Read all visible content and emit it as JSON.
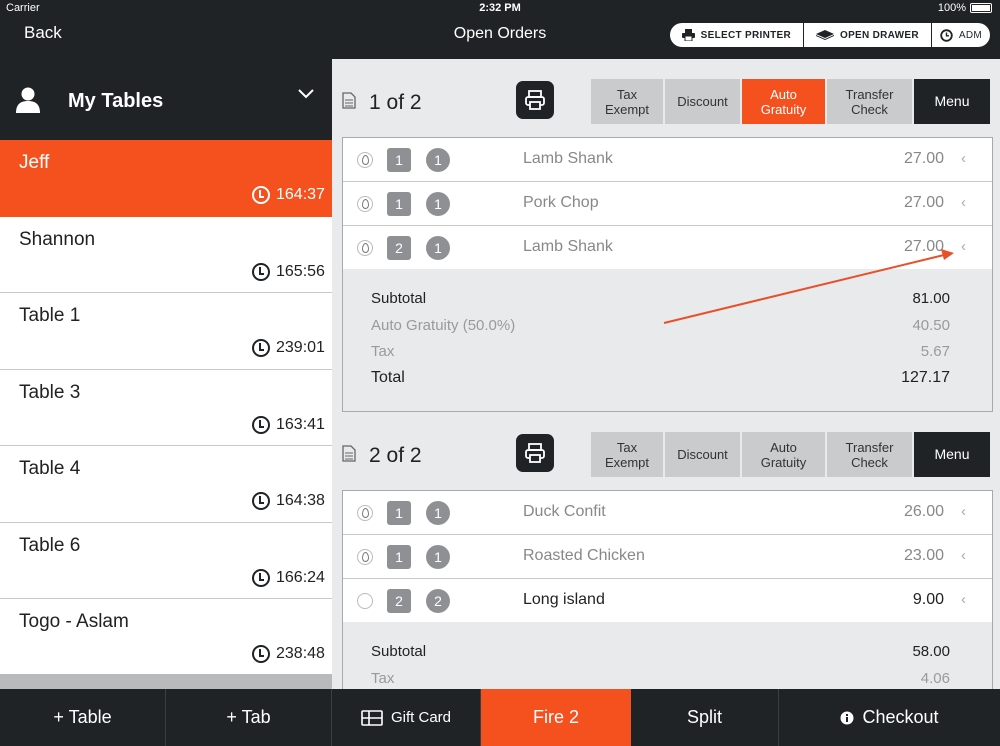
{
  "status": {
    "carrier": "Carrier",
    "time": "2:32 PM",
    "battery": "100%"
  },
  "nav": {
    "back": "Back",
    "title": "Open Orders",
    "select_printer": "SELECT PRINTER",
    "open_drawer": "OPEN DRAWER",
    "user": "ADM"
  },
  "left": {
    "title": "My Tables",
    "tables": [
      {
        "name": "Jeff",
        "timer": "164:37"
      },
      {
        "name": "Shannon",
        "timer": "165:56"
      },
      {
        "name": "Table 1",
        "timer": "239:01"
      },
      {
        "name": "Table 3",
        "timer": "163:41"
      },
      {
        "name": "Table 4",
        "timer": "164:38"
      },
      {
        "name": "Table 6",
        "timer": "166:24"
      },
      {
        "name": "Togo - Aslam",
        "timer": "238:48"
      }
    ]
  },
  "actions": {
    "tax_exempt_1": "Tax",
    "tax_exempt_2": "Exempt",
    "discount": "Discount",
    "auto_gratuity_1": "Auto",
    "auto_gratuity_2": "Gratuity",
    "transfer_1": "Transfer",
    "transfer_2": "Check",
    "menu": "Menu"
  },
  "checks": [
    {
      "label": "1 of 2",
      "items": [
        {
          "seat": "1",
          "qty": "1",
          "name": "Lamb Shank",
          "price": "27.00"
        },
        {
          "seat": "1",
          "qty": "1",
          "name": "Pork Chop",
          "price": "27.00"
        },
        {
          "seat": "2",
          "qty": "1",
          "name": "Lamb Shank",
          "price": "27.00"
        }
      ],
      "subtotal_label": "Subtotal",
      "subtotal": "81.00",
      "gratuity_label": "Auto Gratuity (50.0%)",
      "gratuity": "40.50",
      "tax_label": "Tax",
      "tax": "5.67",
      "total_label": "Total",
      "total": "127.17"
    },
    {
      "label": "2 of 2",
      "items": [
        {
          "seat": "1",
          "qty": "1",
          "name": "Duck Confit",
          "price": "26.00"
        },
        {
          "seat": "1",
          "qty": "1",
          "name": "Roasted Chicken",
          "price": "23.00"
        },
        {
          "seat": "2",
          "qty": "2",
          "name": "Long island",
          "price": "9.00"
        }
      ],
      "subtotal_label": "Subtotal",
      "subtotal": "58.00",
      "tax_label": "Tax",
      "tax": "4.06"
    }
  ],
  "bottom": {
    "add_table": "+ Table",
    "add_tab": "+ Tab",
    "gift_card": "Gift Card",
    "fire": "Fire 2",
    "split": "Split",
    "checkout": "Checkout"
  },
  "colors": {
    "accent": "#f4511e",
    "dark": "#1f2326",
    "annotation_arrow": "#e8502a"
  }
}
